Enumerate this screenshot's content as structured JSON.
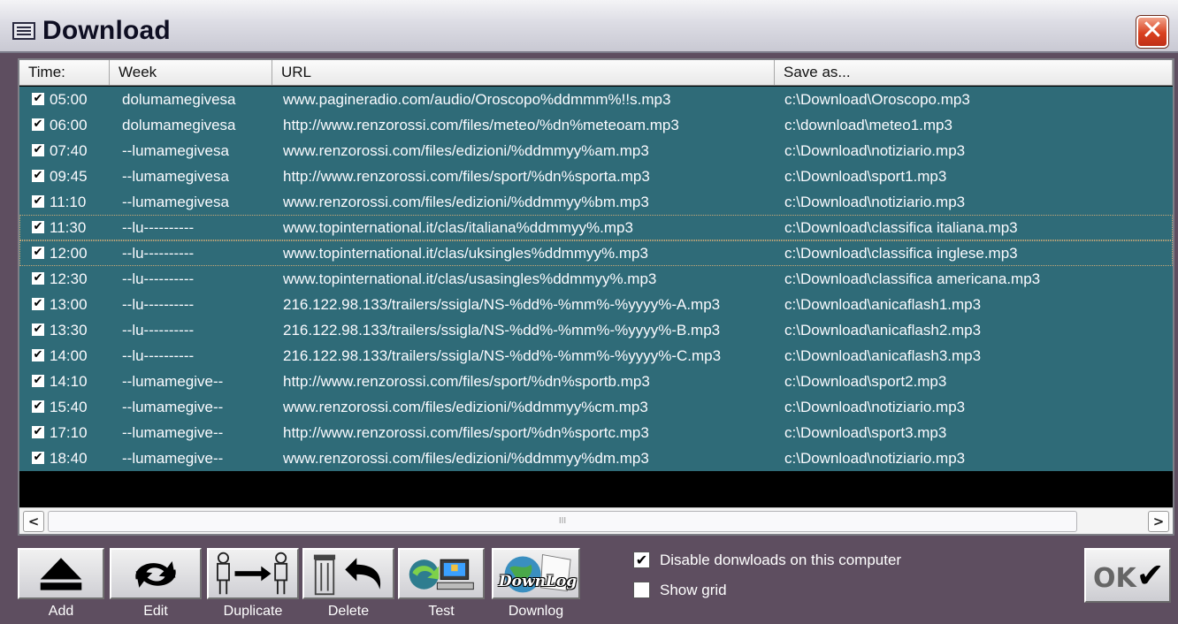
{
  "window": {
    "title": "Download",
    "close_glyph": "✕"
  },
  "columns": [
    "Time:",
    "Week",
    "URL",
    "Save as..."
  ],
  "rows": [
    {
      "checked": true,
      "time": "05:00",
      "week": "dolumamegivesa",
      "url": "www.pagineradio.com/audio/Oroscopo%ddmmm%!!s.mp3",
      "save": "c:\\Download\\Oroscopo.mp3"
    },
    {
      "checked": true,
      "time": "06:00",
      "week": "dolumamegivesa",
      "url": "http://www.renzorossi.com/files/meteo/%dn%meteoam.mp3",
      "save": "c:\\download\\meteo1.mp3"
    },
    {
      "checked": true,
      "time": "07:40",
      "week": "--lumamegivesa",
      "url": "www.renzorossi.com/files/edizioni/%ddmmyy%am.mp3",
      "save": "c:\\Download\\notiziario.mp3"
    },
    {
      "checked": true,
      "time": "09:45",
      "week": "--lumamegivesa",
      "url": "http://www.renzorossi.com/files/sport/%dn%sporta.mp3",
      "save": "c:\\Download\\sport1.mp3"
    },
    {
      "checked": true,
      "time": "11:10",
      "week": "--lumamegivesa",
      "url": "www.renzorossi.com/files/edizioni/%ddmmyy%bm.mp3",
      "save": "c:\\Download\\notiziario.mp3"
    },
    {
      "checked": true,
      "time": "11:30",
      "week": "--lu----------",
      "url": "www.topinternational.it/clas/italiana%ddmmyy%.mp3",
      "save": "c:\\Download\\classifica italiana.mp3"
    },
    {
      "checked": true,
      "time": "12:00",
      "week": "--lu----------",
      "url": "www.topinternational.it/clas/uksingles%ddmmyy%.mp3",
      "save": "c:\\Download\\classifica inglese.mp3"
    },
    {
      "checked": true,
      "time": "12:30",
      "week": "--lu----------",
      "url": "www.topinternational.it/clas/usasingles%ddmmyy%.mp3",
      "save": "c:\\Download\\classifica americana.mp3"
    },
    {
      "checked": true,
      "time": "13:00",
      "week": "--lu----------",
      "url": "216.122.98.133/trailers/ssigla/NS-%dd%-%mm%-%yyyy%-A.mp3",
      "save": "c:\\Download\\anicaflash1.mp3"
    },
    {
      "checked": true,
      "time": "13:30",
      "week": "--lu----------",
      "url": "216.122.98.133/trailers/ssigla/NS-%dd%-%mm%-%yyyy%-B.mp3",
      "save": "c:\\Download\\anicaflash2.mp3"
    },
    {
      "checked": true,
      "time": "14:00",
      "week": "--lu----------",
      "url": "216.122.98.133/trailers/ssigla/NS-%dd%-%mm%-%yyyy%-C.mp3",
      "save": "c:\\Download\\anicaflash3.mp3"
    },
    {
      "checked": true,
      "time": "14:10",
      "week": "--lumamegive--",
      "url": "http://www.renzorossi.com/files/sport/%dn%sportb.mp3",
      "save": "c:\\Download\\sport2.mp3"
    },
    {
      "checked": true,
      "time": "15:40",
      "week": "--lumamegive--",
      "url": "www.renzorossi.com/files/edizioni/%ddmmyy%cm.mp3",
      "save": "c:\\Download\\notiziario.mp3"
    },
    {
      "checked": true,
      "time": "17:10",
      "week": "--lumamegive--",
      "url": "http://www.renzorossi.com/files/sport/%dn%sportc.mp3",
      "save": "c:\\Download\\sport3.mp3"
    },
    {
      "checked": true,
      "time": "18:40",
      "week": "--lumamegive--",
      "url": "www.renzorossi.com/files/edizioni/%ddmmyy%dm.mp3",
      "save": "c:\\Download\\notiziario.mp3"
    }
  ],
  "scrollbar": {
    "left_arrow": "<",
    "right_arrow": ">",
    "grip": "III"
  },
  "toolbar": {
    "add": "Add",
    "edit": "Edit",
    "duplicate": "Duplicate",
    "delete": "Delete",
    "test": "Test",
    "downlog": "Downlog",
    "downlog_icon_text": "DownLog"
  },
  "options": {
    "disable": {
      "label": "Disable donwloads on this computer",
      "checked": true
    },
    "grid": {
      "label": "Show grid",
      "checked": false
    }
  },
  "ok_button": {
    "label": "OK",
    "tick": "✔"
  },
  "colors": {
    "row_bg": "#2f6b78",
    "window_bg": "#5e4e60",
    "close_red": "#d9411f"
  }
}
